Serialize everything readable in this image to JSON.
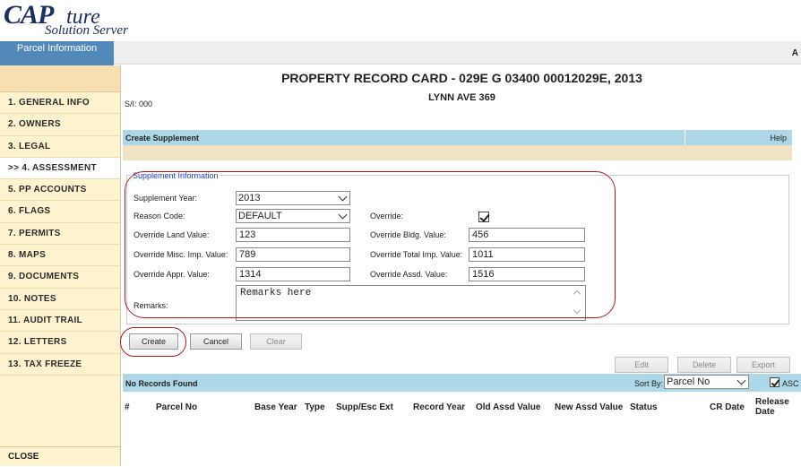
{
  "logo": {
    "cap": "CAP",
    "ture": "ture",
    "sub": "Solution Server"
  },
  "header": {
    "parcel_tab": "Parcel Information",
    "right_letter": "A"
  },
  "sidebar": {
    "items": [
      {
        "label": "1. GENERAL INFO"
      },
      {
        "label": "2. OWNERS"
      },
      {
        "label": "3. LEGAL"
      },
      {
        "label": ">> 4. ASSESSMENT"
      },
      {
        "label": "5. PP ACCOUNTS"
      },
      {
        "label": "6. FLAGS"
      },
      {
        "label": "7. PERMITS"
      },
      {
        "label": "8. MAPS"
      },
      {
        "label": "9. DOCUMENTS"
      },
      {
        "label": "10. NOTES"
      },
      {
        "label": "11. AUDIT TRAIL"
      },
      {
        "label": "12. LETTERS"
      },
      {
        "label": "13. TAX FREEZE"
      }
    ],
    "close": "CLOSE"
  },
  "main": {
    "title": "PROPERTY RECORD CARD - 029E G 03400 00012029E, 2013",
    "address": "LYNN AVE 369",
    "si": "S/I: 000",
    "section_title": "Create Supplement",
    "help": "Help",
    "legend": "Supplement Information",
    "form": {
      "supplement_year_label": "Supplement Year:",
      "supplement_year_value": "2013",
      "reason_code_label": "Reason Code:",
      "reason_code_value": "DEFAULT",
      "override_label": "Override:",
      "override_land_label": "Override Land Value:",
      "override_land_value": "123",
      "override_bldg_label": "Override Bldg. Value:",
      "override_bldg_value": "456",
      "override_misc_label": "Override Misc. Imp. Value:",
      "override_misc_value": "789",
      "override_total_label": "Override Total Imp. Value:",
      "override_total_value": "1011",
      "override_appr_label": "Override Appr. Value:",
      "override_appr_value": "1314",
      "override_assd_label": "Override Assd. Value:",
      "override_assd_value": "1516",
      "remarks_label": "Remarks:",
      "remarks_value": "Remarks here"
    },
    "buttons": {
      "create": "Create",
      "cancel": "Cancel",
      "clear": "Clear",
      "edit": "Edit",
      "delete": "Delete",
      "export": "Export"
    },
    "grid": {
      "no_records": "No Records Found",
      "sort_by_label": "Sort By:",
      "sort_by_value": "Parcel No",
      "asc_label": "ASC",
      "columns": [
        "#",
        "Parcel No",
        "Base Year",
        "Type",
        "Supp/Esc Ext",
        "Record Year",
        "Old Assd Value",
        "New Assd Value",
        "Status",
        "CR Date",
        "Release",
        "Date"
      ]
    }
  },
  "colors": {
    "tab_blue": "#5289b8",
    "section_blue": "#add6e6",
    "sidebar_bg": "#fdf4cf",
    "annotation_red": "#b3181e"
  }
}
